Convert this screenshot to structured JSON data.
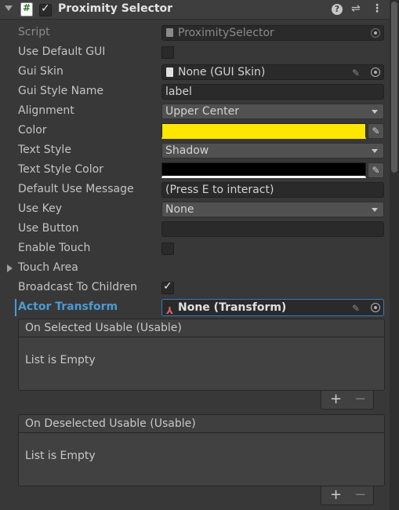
{
  "component": {
    "title": "Proximity Selector",
    "enabled": true
  },
  "header_icons": {
    "help": "?",
    "settings": "⇌",
    "menu": "⋮"
  },
  "fields": [
    {
      "label": "Script",
      "value": "ProximitySelector"
    },
    {
      "label": "Use Default GUI"
    },
    {
      "label": "Gui Skin",
      "value": "None (GUI Skin)"
    },
    {
      "label": "Gui Style Name",
      "value": "label"
    },
    {
      "label": "Alignment",
      "value": "Upper Center"
    },
    {
      "label": "Color",
      "color": "#fde600"
    },
    {
      "label": "Text Style",
      "value": "Shadow"
    },
    {
      "label": "Text Style Color",
      "color": "#000000"
    },
    {
      "label": "Default Use Message",
      "value": "(Press E to interact)"
    },
    {
      "label": "Use Key",
      "value": "None"
    },
    {
      "label": "Use Button",
      "value": ""
    },
    {
      "label": "Enable Touch"
    },
    {
      "label": "Touch Area"
    },
    {
      "label": "Broadcast To Children"
    },
    {
      "label": "Actor Transform",
      "value": "None (Transform)"
    }
  ],
  "events": [
    {
      "title": "On Selected Usable (Usable)",
      "empty": "List is Empty"
    },
    {
      "title": "On Deselected Usable (Usable)",
      "empty": "List is Empty"
    }
  ],
  "list_buttons": {
    "add": "+",
    "remove": "−"
  },
  "colors": {
    "accent": "#4a9bd4",
    "color_field": "#fde600"
  }
}
